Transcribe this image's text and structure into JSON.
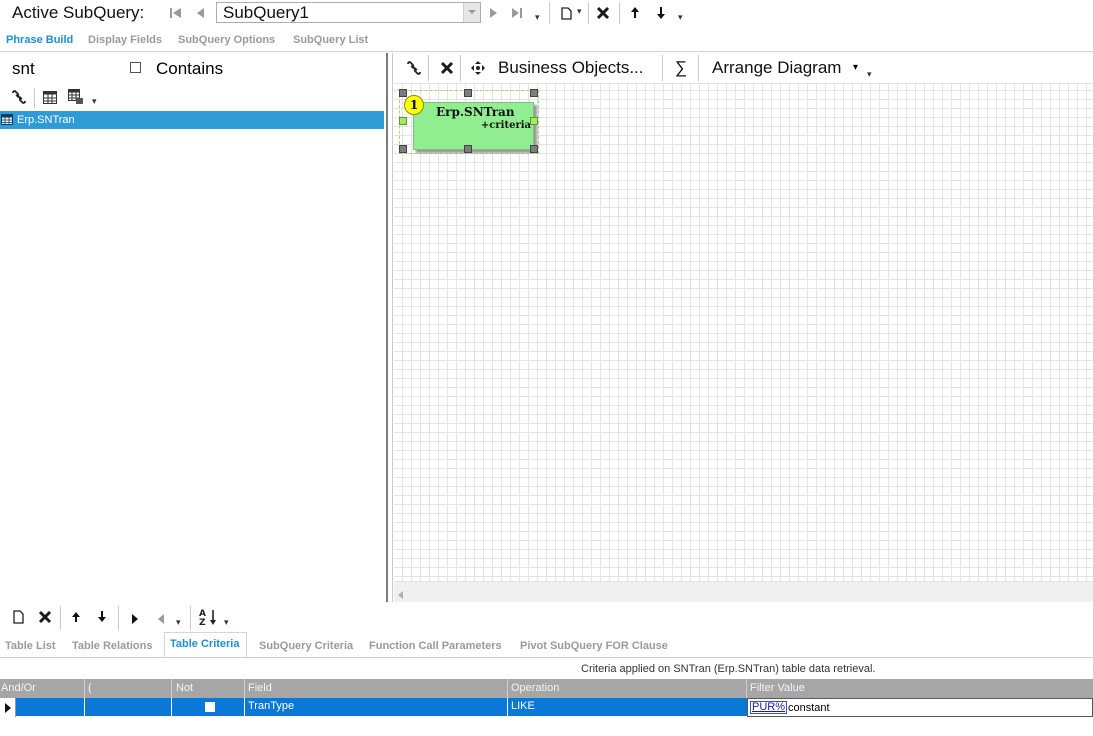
{
  "toolbar": {
    "active_label": "Active SubQuery:",
    "combo_value": "SubQuery1"
  },
  "top_tabs": [
    {
      "label": "Phrase Build",
      "active": true
    },
    {
      "label": "Display Fields",
      "active": false
    },
    {
      "label": "SubQuery Options",
      "active": false
    },
    {
      "label": "SubQuery List",
      "active": false
    }
  ],
  "left": {
    "search_text": "snt",
    "contains_label": "Contains",
    "contains_checked": false,
    "tree_items": [
      "Erp.SNTran"
    ]
  },
  "diagram_toolbar": {
    "business_objects": "Business Objects...",
    "sum_symbol": "∑",
    "arrange": "Arrange Diagram"
  },
  "diagram": {
    "object_number": "1",
    "object_title": "Erp.SNTran",
    "object_sub": "+criteria"
  },
  "bottom_tabs": [
    {
      "label": "Table List",
      "active": false
    },
    {
      "label": "Table Relations",
      "active": false
    },
    {
      "label": "Table Criteria",
      "active": true
    },
    {
      "label": "SubQuery Criteria",
      "active": false
    },
    {
      "label": "Function Call Parameters",
      "active": false
    },
    {
      "label": "Pivot SubQuery FOR Clause",
      "active": false
    }
  ],
  "criteria": {
    "info": "Criteria applied on SNTran (Erp.SNTran)  table data retrieval.",
    "columns": [
      "And/Or",
      "(",
      "Not",
      "Field",
      "Operation",
      "Filter Value"
    ],
    "rows": [
      {
        "and_or": "",
        "paren": "",
        "not": false,
        "field": "TranType",
        "operation": "LIKE",
        "filter_value": "PUR%",
        "filter_kind": "constant"
      }
    ]
  },
  "colors": {
    "accent": "#1e8fd0",
    "selection": "#0a78d7",
    "tree_selection": "#2e9ad6",
    "object_fill": "#90ee90"
  }
}
